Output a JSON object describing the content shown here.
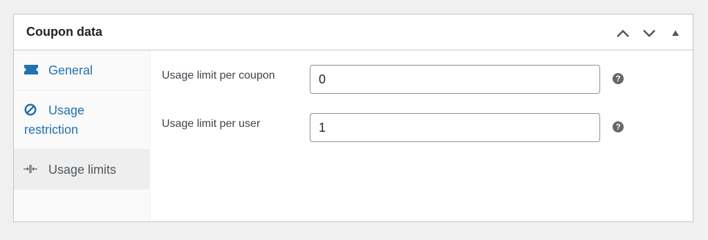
{
  "postbox": {
    "title": "Coupon data",
    "handle_actions": [
      {
        "icon": "chevron-up-icon"
      },
      {
        "icon": "chevron-down-icon"
      },
      {
        "icon": "triangle-up-icon"
      }
    ]
  },
  "tabs": [
    {
      "label": "General",
      "icon": "ticket-icon",
      "active": false
    },
    {
      "label_line1": "Usage",
      "label_line2": "restriction",
      "icon": "prohibited-icon",
      "active": false
    },
    {
      "label": "Usage limits",
      "icon": "arrows-in-icon",
      "active": true
    }
  ],
  "fields": [
    {
      "label": "Usage limit per coupon",
      "value": "0",
      "help": "?"
    },
    {
      "label": "Usage limit per user",
      "value": "1",
      "help": "?"
    }
  ],
  "colors": {
    "link": "#2271b1",
    "active_tab_bg": "#eeeeee",
    "border": "#c3c4c7",
    "page_bg": "#f0f0f1"
  }
}
